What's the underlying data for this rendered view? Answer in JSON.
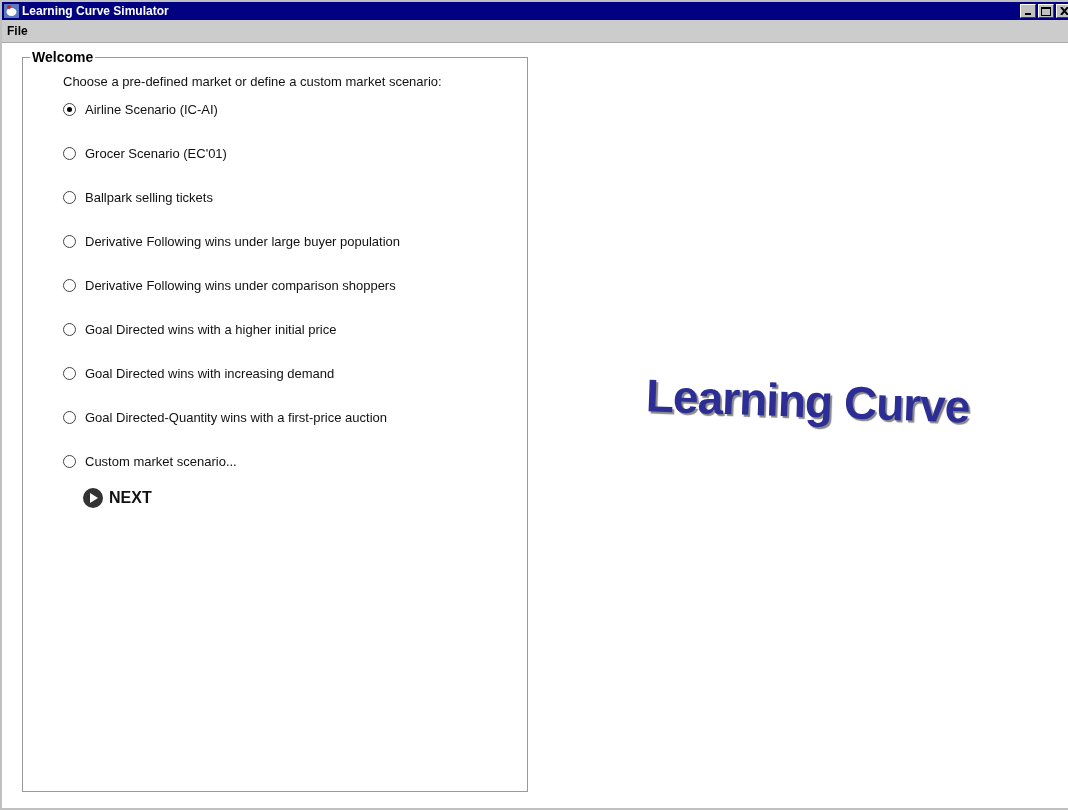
{
  "window": {
    "title": "Learning Curve Simulator"
  },
  "menu": [
    "File"
  ],
  "panel": {
    "legend": "Welcome",
    "prompt": "Choose a pre-defined market or define a custom market scenario:",
    "options": [
      {
        "label": "Airline Scenario (IC-AI)",
        "selected": true
      },
      {
        "label": "Grocer Scenario (EC'01)",
        "selected": false
      },
      {
        "label": "Ballpark selling tickets",
        "selected": false
      },
      {
        "label": "Derivative Following wins under large buyer population",
        "selected": false
      },
      {
        "label": "Derivative Following wins under comparison shoppers",
        "selected": false
      },
      {
        "label": "Goal Directed wins with a higher initial price",
        "selected": false
      },
      {
        "label": "Goal Directed wins with increasing demand",
        "selected": false
      },
      {
        "label": "Goal Directed-Quantity wins with a first-price auction",
        "selected": false
      },
      {
        "label": "Custom market scenario...",
        "selected": false
      }
    ],
    "next": "NEXT"
  },
  "logo": "Learning Curve"
}
